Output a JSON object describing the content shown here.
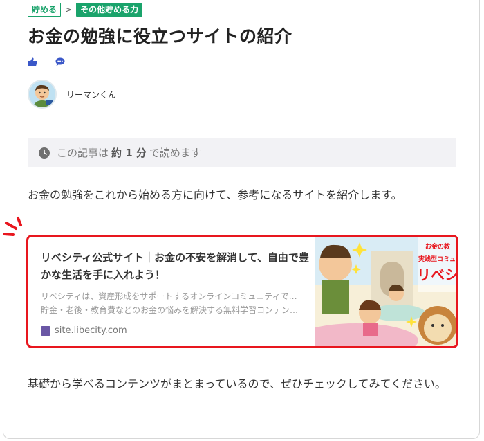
{
  "breadcrumb": {
    "category": "貯める",
    "separator": ">",
    "subcategory": "その他貯める力"
  },
  "title": "お金の勉強に役立つサイトの紹介",
  "reactions": {
    "likes": "-",
    "comments": "-"
  },
  "author": {
    "name": "リーマンくん"
  },
  "read_time": {
    "prefix": "この記事は",
    "amount": "約 1 分",
    "suffix": "で読めます"
  },
  "paragraphs": {
    "intro": "お金の勉強をこれから始める方に向けて、参考になるサイトを紹介します。",
    "outro": "基礎から学べるコンテンツがまとまっているので、ぜひチェックしてみてください。"
  },
  "link_card": {
    "title": "リベシティ公式サイト｜お金の不安を解消して、自由で豊かな生活を手に入れよう！",
    "desc_line1": "リベシティは、資産形成をサポートするオンラインコミュニティです。",
    "desc_line2": "貯金・老後・教育費などのお金の悩みを解決する無料学習コンテン…",
    "site": "site.libecity.com",
    "image_text_top": "お金の教",
    "image_text_mid": "実践型コミュ",
    "image_logo": "リベシ"
  },
  "colors": {
    "accent_green": "#1aa36b",
    "highlight_red": "#e8161e",
    "icon_blue": "#3a57c8"
  }
}
